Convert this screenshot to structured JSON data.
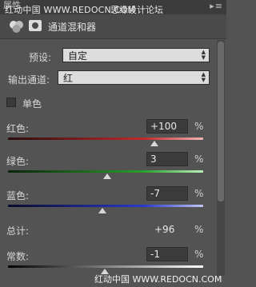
{
  "titlebar": {
    "title": "属性",
    "watermark_left": "红动中国 WWW.REDOCN.COM",
    "watermark_right": "思缘设计论坛",
    "menu_icon": "panel-menu-icon"
  },
  "panel": {
    "title": "通道混和器",
    "adjustment_icon": "channel-mixer-icon",
    "mask_icon": "layer-mask-icon"
  },
  "preset": {
    "label": "预设:",
    "value": "自定"
  },
  "output_channel": {
    "label": "输出通道:",
    "value": "红"
  },
  "monochrome": {
    "label": "单色",
    "checked": false
  },
  "sliders": [
    {
      "label": "红色:",
      "value": "+100",
      "unit": "%",
      "level": 100,
      "color": "#c22a2a"
    },
    {
      "label": "绿色:",
      "value": "3",
      "unit": "%",
      "level": 3,
      "color": "#2aa02a"
    },
    {
      "label": "蓝色:",
      "value": "-7",
      "unit": "%",
      "level": -7,
      "color": "#2a3acb"
    }
  ],
  "total": {
    "label": "总计:",
    "value": "+96",
    "unit": "%"
  },
  "constant": {
    "label": "常数:",
    "value": "-1",
    "unit": "%",
    "level": -1
  },
  "footer_watermark": "红动中国 WWW.REDOCN.COM"
}
